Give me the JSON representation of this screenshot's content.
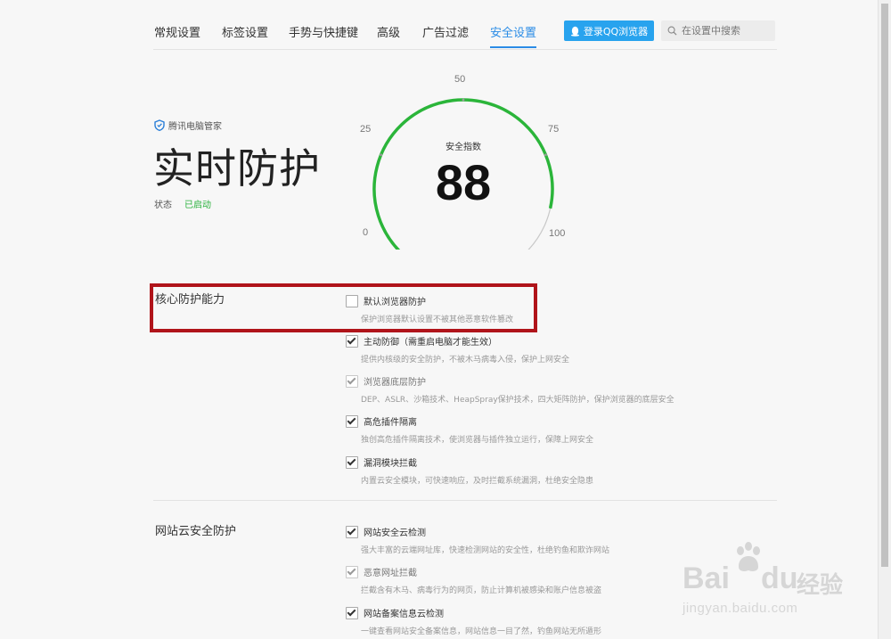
{
  "tabs": [
    {
      "label": "常规设置"
    },
    {
      "label": "标签设置"
    },
    {
      "label": "手势与快捷键"
    },
    {
      "label": "高级"
    },
    {
      "label": "广告过滤"
    },
    {
      "label": "安全设置"
    }
  ],
  "active_tab": "安全设置",
  "login_button": "登录QQ浏览器",
  "search": {
    "placeholder": "在设置中搜索"
  },
  "hero": {
    "brand": "腾讯电脑管家",
    "title": "实时防护",
    "status_label": "状态",
    "status_value": "已启动"
  },
  "gauge": {
    "title": "安全指数",
    "value": 88,
    "ticks": [
      "0",
      "25",
      "50",
      "75",
      "100"
    ],
    "accent": "#2bb53a"
  },
  "sections": [
    {
      "title": "核心防护能力",
      "items": [
        {
          "label": "默认浏览器防护",
          "desc": "保护浏览器默认设置不被其他恶意软件篡改",
          "checked": false,
          "dim": false
        },
        {
          "label": "主动防御（需重启电脑才能生效）",
          "desc": "提供内核级的安全防护，不被木马病毒入侵，保护上网安全",
          "checked": true,
          "dim": false
        },
        {
          "label": "浏览器底层防护",
          "desc": "DEP、ASLR、沙箱技术、HeapSpray保护技术，四大矩阵防护，保护浏览器的底层安全",
          "checked": true,
          "dim": true
        },
        {
          "label": "高危插件隔离",
          "desc": "独创高危插件隔离技术，使浏览器与插件独立运行，保障上网安全",
          "checked": true,
          "dim": false
        },
        {
          "label": "漏洞模块拦截",
          "desc": "内置云安全模块，可快速响应，及时拦截系统漏洞，杜绝安全隐患",
          "checked": true,
          "dim": false
        }
      ]
    },
    {
      "title": "网站云安全防护",
      "items": [
        {
          "label": "网站安全云检测",
          "desc": "强大丰富的云端网址库，快速检测网站的安全性，杜绝钓鱼和欺诈网站",
          "checked": true,
          "dim": false
        },
        {
          "label": "恶意网址拦截",
          "desc": "拦截含有木马、病毒行为的网页，防止计算机被感染和账户信息被盗",
          "checked": true,
          "dim": true
        },
        {
          "label": "网站备案信息云检测",
          "desc": "一键查看网站安全备案信息，网站信息一目了然，钓鱼网站无所遁形",
          "checked": true,
          "dim": false
        }
      ]
    }
  ],
  "watermark": {
    "line1": "Bai",
    "line2": "du",
    "cn": "经验",
    "url": "jingyan.baidu.com"
  }
}
